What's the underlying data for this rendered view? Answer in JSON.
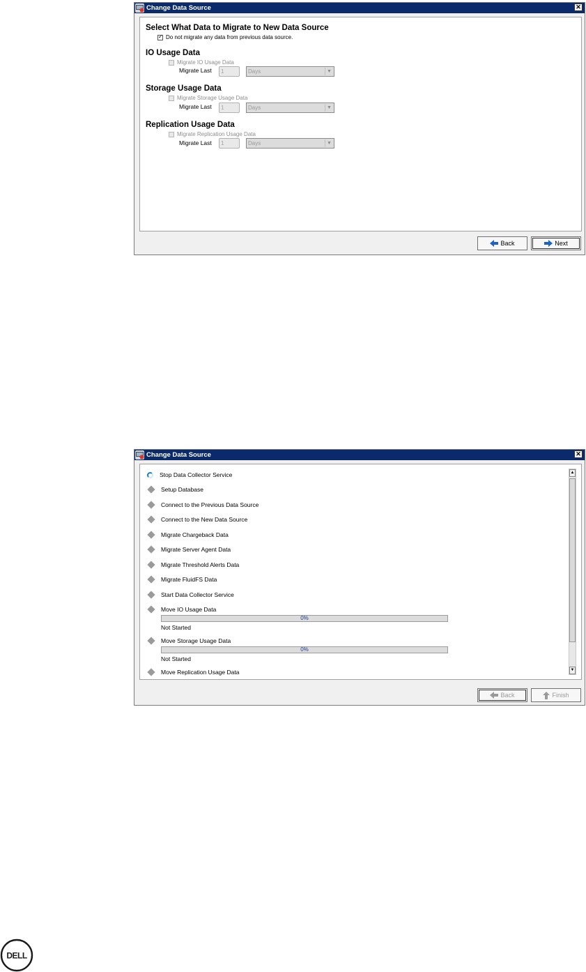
{
  "dialog1": {
    "title": "Change Data Source",
    "close": "✕",
    "heading": "Select What Data to Migrate to New Data Source",
    "no_migrate_checkbox": {
      "label": "Do not migrate any data from previous data source.",
      "checked": true
    },
    "sections": [
      {
        "heading": "IO Usage Data",
        "checkbox_label": "Migrate IO Usage Data",
        "migrate_last_label": "Migrate Last",
        "value": "1",
        "unit": "Days"
      },
      {
        "heading": "Storage Usage Data",
        "checkbox_label": "Migrate Storage Usage Data",
        "migrate_last_label": "Migrate Last",
        "value": "1",
        "unit": "Days"
      },
      {
        "heading": "Replication Usage Data",
        "checkbox_label": "Migrate Replication Usage Data",
        "migrate_last_label": "Migrate Last",
        "value": "1",
        "unit": "Days"
      }
    ],
    "buttons": {
      "back": "Back",
      "next": "Next"
    }
  },
  "dialog2": {
    "title": "Change Data Source",
    "close": "✕",
    "steps": [
      {
        "label": "Stop Data Collector Service",
        "state": "in-progress"
      },
      {
        "label": "Setup Database",
        "state": "pending"
      },
      {
        "label": "Connect to the Previous Data Source",
        "state": "pending"
      },
      {
        "label": "Connect to the New Data Source",
        "state": "pending"
      },
      {
        "label": "Migrate Chargeback Data",
        "state": "pending"
      },
      {
        "label": "Migrate Server Agent Data",
        "state": "pending"
      },
      {
        "label": "Migrate Threshold Alerts Data",
        "state": "pending"
      },
      {
        "label": "Migrate FluidFS Data",
        "state": "pending"
      },
      {
        "label": "Start Data Collector Service",
        "state": "pending"
      },
      {
        "label": "Move IO Usage Data",
        "state": "pending",
        "progress_text": "0%",
        "progress": 0,
        "status": "Not Started"
      },
      {
        "label": "Move Storage Usage Data",
        "state": "pending",
        "progress_text": "0%",
        "progress": 0,
        "status": "Not Started"
      },
      {
        "label": "Move Replication Usage Data",
        "state": "pending"
      }
    ],
    "buttons": {
      "back": "Back",
      "finish": "Finish"
    }
  },
  "footer": {
    "logo": "DELL"
  },
  "colors": {
    "titlebar": "#0b2a6b",
    "arrow_blue": "#1b63c6",
    "spinner": "#1b7fc0",
    "progress_text": "#1a3e8c"
  }
}
